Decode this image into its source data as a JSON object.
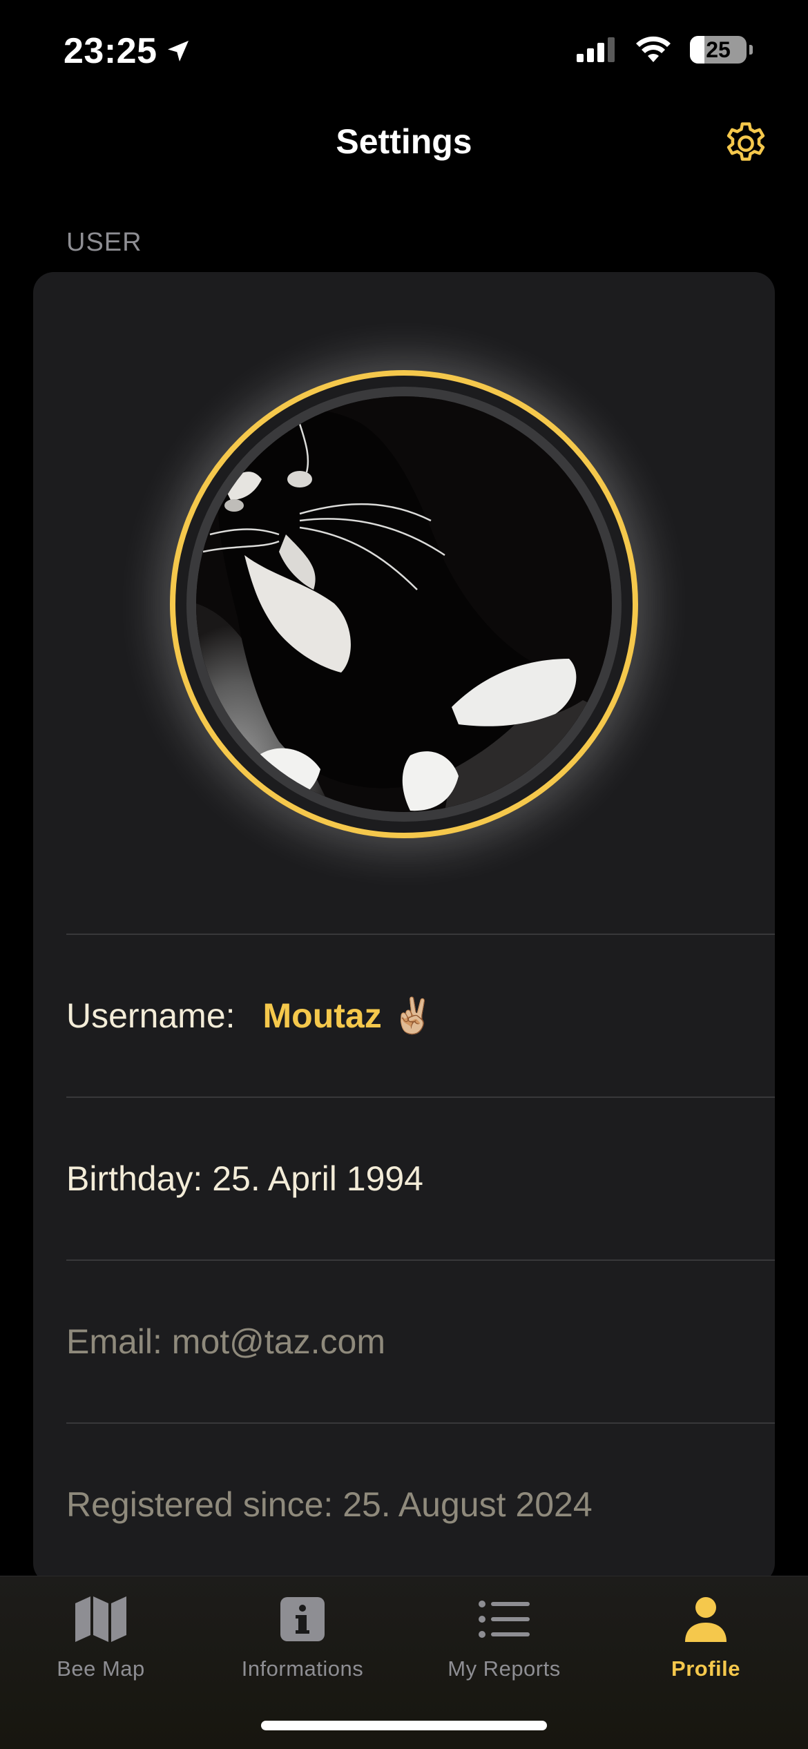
{
  "status_bar": {
    "time": "23:25",
    "battery_level": "25",
    "battery_fraction": 0.25
  },
  "nav": {
    "title": "Settings"
  },
  "section": {
    "header": "USER"
  },
  "profile": {
    "username_label": "Username:",
    "username_value": "Moutaz ✌🏼",
    "birthday": "Birthday: 25. April 1994",
    "email": "Email: mot@taz.com",
    "registered": "Registered since: 25. August 2024"
  },
  "tabs": [
    {
      "label": "Bee Map",
      "icon": "map-icon",
      "active": false
    },
    {
      "label": "Informations",
      "icon": "info-icon",
      "active": false
    },
    {
      "label": "My Reports",
      "icon": "list-icon",
      "active": false
    },
    {
      "label": "Profile",
      "icon": "person-icon",
      "active": true
    }
  ],
  "colors": {
    "accent": "#f5c84c",
    "background": "#000000",
    "card": "#1c1c1e",
    "inactive_tab": "#8e8e93"
  }
}
